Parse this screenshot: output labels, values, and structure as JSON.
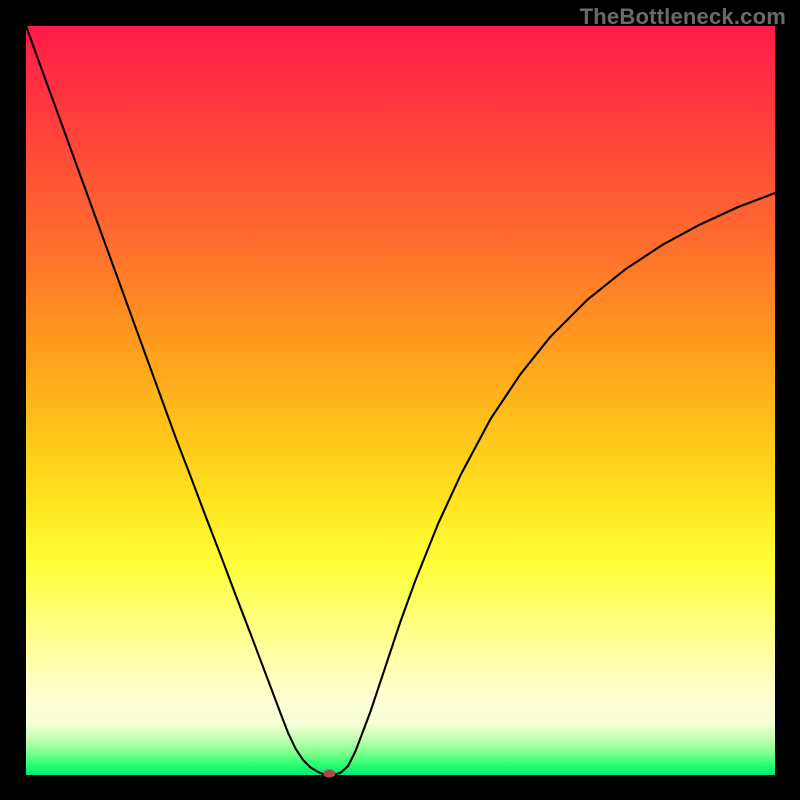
{
  "watermark": "TheBottleneck.com",
  "chart_data": {
    "type": "line",
    "title": "",
    "xlabel": "",
    "ylabel": "",
    "xlim": [
      0,
      100
    ],
    "ylim": [
      0,
      100
    ],
    "grid": false,
    "series": [
      {
        "name": "bottleneck-curve",
        "x": [
          0,
          2,
          4,
          6,
          8,
          10,
          12,
          14,
          16,
          18,
          20,
          22,
          24,
          26,
          28,
          30,
          32,
          34,
          35,
          36,
          37,
          38,
          39,
          40,
          41,
          42,
          43,
          44,
          46,
          48,
          50,
          52,
          55,
          58,
          62,
          66,
          70,
          75,
          80,
          85,
          90,
          95,
          100
        ],
        "y": [
          100,
          94.5,
          89,
          83.5,
          78,
          72.5,
          67,
          61.5,
          56,
          50.5,
          45,
          39.8,
          34.5,
          29.3,
          24,
          18.8,
          13.5,
          8.2,
          5.6,
          3.5,
          2,
          1,
          0.4,
          0,
          0,
          0.3,
          1.2,
          3.2,
          8.5,
          14.5,
          20.5,
          26,
          33.5,
          40,
          47.5,
          53.5,
          58.5,
          63.5,
          67.5,
          70.8,
          73.5,
          75.8,
          77.7
        ]
      }
    ],
    "marker": {
      "x": 40.5,
      "y": 0.2,
      "name": "optimal-point"
    },
    "background_gradient": {
      "top": "#ff1a4b",
      "mid": "#ffe61f",
      "bottom": "#00e879"
    },
    "frame_border_color": "#000000",
    "frame_border_width_px": 26
  }
}
